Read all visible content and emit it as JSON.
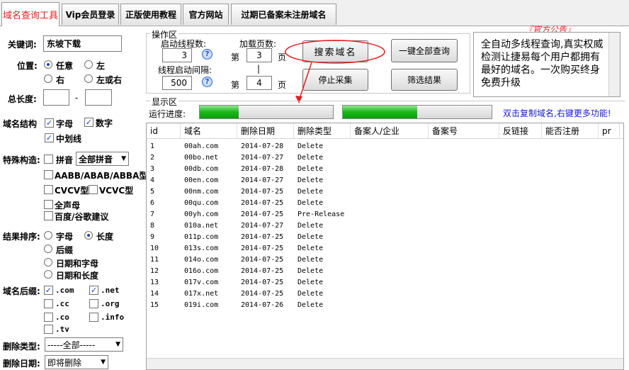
{
  "tabs": [
    {
      "label": "域名查询工具"
    },
    {
      "label": "Vip会员登录"
    },
    {
      "label": "正版使用教程"
    },
    {
      "label": "官方网站"
    },
    {
      "label": "过期已备案未注册域名"
    }
  ],
  "left": {
    "keyword_label": "关键词:",
    "keyword_value": "东坡下载",
    "position_label": "位置:",
    "position_options": [
      "任意",
      "左",
      "右",
      "左或右"
    ],
    "length_label": "总长度:",
    "length_sep": "-",
    "struct_label": "域名结构",
    "struct_options": [
      "字母",
      "数字",
      "中划线"
    ],
    "special_label": "特殊构造:",
    "pinyin_label": "拼音",
    "pinyin_select": "全部拼音",
    "special_options": [
      "AABB/ABAB/ABBA型",
      "CVCV型",
      "VCVC型",
      "全声母",
      "百度/谷歌建议"
    ],
    "sort_label": "结果排序:",
    "sort_options": [
      "字母",
      "长度",
      "后缀",
      "日期和字母",
      "日期和长度"
    ],
    "suffix_label": "域名后缀:",
    "suffix_options": [
      ".com",
      ".net",
      ".cc",
      ".org",
      ".co",
      ".info",
      ".tv"
    ],
    "delete_type_label": "删除类型:",
    "delete_type_value": "-----全部-----",
    "delete_date_label": "删除日期:",
    "delete_date_value": "即将删除"
  },
  "ops": {
    "title": "操作区",
    "threads_label": "启动线程数:",
    "threads_value": "3",
    "interval_label": "线程启动间隔:",
    "interval_value": "500",
    "pages_label": "加载页数:",
    "page_prefix": "第",
    "page_suffix": "页",
    "page_from": "3",
    "page_sep": "|",
    "page_to": "4",
    "help": "?",
    "search_button": "搜索域名",
    "stop_button": "停止采集",
    "query_all_button": "一键全部查询",
    "filter_button": "筛选结果"
  },
  "notice": {
    "title": "『官方公告』",
    "text": "全自动多线程查询,真实权威检测让捷易每个用户都拥有最好的域名。一次购买终身免费升级"
  },
  "display": {
    "title": "显示区",
    "progress_label": "运行进度:",
    "progress1": 0.29,
    "progress2": 0.5,
    "hint": "双击复制域名,右键更多功能!"
  },
  "table": {
    "columns": [
      "id",
      "域名",
      "删除日期",
      "删除类型",
      "备案人/企业",
      "备案号",
      "反链接",
      "能否注册",
      "pr"
    ],
    "rows": [
      [
        "1",
        "00ah.com",
        "2014-07-28",
        "Delete"
      ],
      [
        "2",
        "00bo.net",
        "2014-07-27",
        "Delete"
      ],
      [
        "3",
        "00db.com",
        "2014-07-28",
        "Delete"
      ],
      [
        "4",
        "00en.com",
        "2014-07-27",
        "Delete"
      ],
      [
        "5",
        "00nm.com",
        "2014-07-25",
        "Delete"
      ],
      [
        "6",
        "00qu.com",
        "2014-07-25",
        "Delete"
      ],
      [
        "7",
        "00yh.com",
        "2014-07-25",
        "Pre-Release"
      ],
      [
        "8",
        "010a.net",
        "2014-07-27",
        "Delete"
      ],
      [
        "9",
        "011p.com",
        "2014-07-25",
        "Delete"
      ],
      [
        "10",
        "013s.com",
        "2014-07-25",
        "Delete"
      ],
      [
        "11",
        "014o.com",
        "2014-07-25",
        "Delete"
      ],
      [
        "12",
        "016o.com",
        "2014-07-25",
        "Delete"
      ],
      [
        "13",
        "017v.com",
        "2014-07-25",
        "Delete"
      ],
      [
        "14",
        "017x.net",
        "2014-07-25",
        "Delete"
      ],
      [
        "15",
        "019i.com",
        "2014-07-26",
        "Delete"
      ]
    ]
  },
  "colors": {
    "accent": "#e02020",
    "hint": "#1a1ad0",
    "progress": "#18b818"
  }
}
